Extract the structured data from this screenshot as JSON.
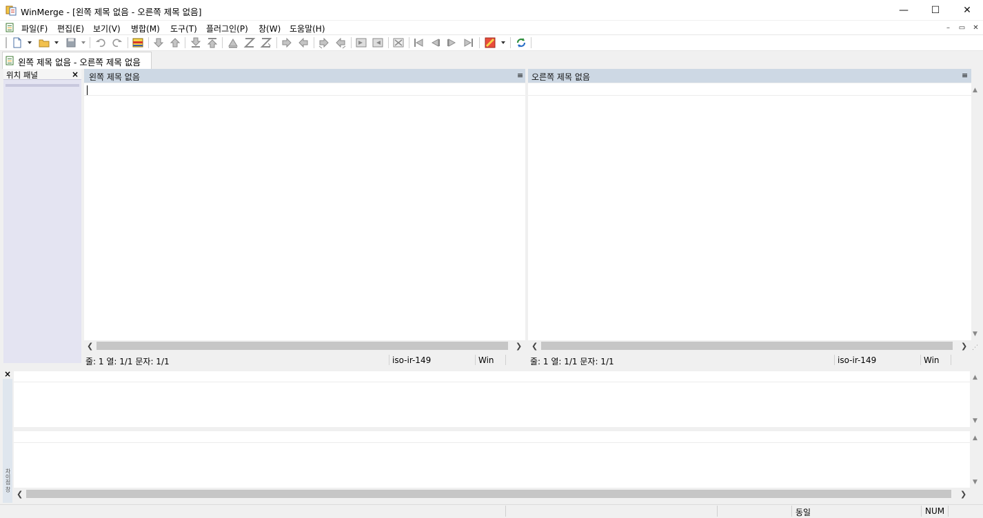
{
  "window": {
    "title": "WinMerge - [왼쪽 제목 없음 - 오른쪽 제목 없음]",
    "minimize_glyph": "—",
    "maximize_glyph": "☐",
    "close_glyph": "✕"
  },
  "menu": {
    "items": [
      "파일(F)",
      "편집(E)",
      "보기(V)",
      "병합(M)",
      "도구(T)",
      "플러그인(P)",
      "창(W)",
      "도움말(H)"
    ],
    "mdi_minimize": "–",
    "mdi_restore": "▭",
    "mdi_close": "✕"
  },
  "toolbar": {
    "icons": [
      "new-document-icon",
      "open-folder-icon",
      "save-icon",
      "undo-icon",
      "redo-icon",
      "filter-icon",
      "next-diff-icon",
      "prev-diff-icon",
      "first-diff-icon",
      "last-diff-icon",
      "current-diff-icon",
      "next-conflict-icon",
      "prev-conflict-icon",
      "copy-right-icon",
      "copy-left-icon",
      "copy-right-advance-icon",
      "copy-left-advance-icon",
      "copy-all-right-icon",
      "copy-all-left-icon",
      "all-icon",
      "first-file-icon",
      "prev-file-icon",
      "next-file-icon",
      "last-file-icon",
      "options-icon",
      "refresh-icon"
    ]
  },
  "tab": {
    "label": "왼쪽 제목 없음 - 오른쪽 제목 없음"
  },
  "location_pane": {
    "title": "위치 패널",
    "close": "×"
  },
  "left_pane": {
    "header": "왼쪽 제목 없음",
    "menu_glyph": "≡",
    "status": {
      "position": "줄: 1  열: 1/1  문자: 1/1",
      "encoding": "iso-ir-149",
      "eol": "Win"
    }
  },
  "right_pane": {
    "header": "오른쪽 제목 없음",
    "menu_glyph": "≡",
    "status": {
      "position": "줄: 1  열: 1/1  문자: 1/1",
      "encoding": "iso-ir-149",
      "eol": "Win"
    }
  },
  "detail_pane": {
    "close": "×",
    "side_label": "차이점 창"
  },
  "statusbar": {
    "result": "동일",
    "num": "NUM"
  },
  "colors": {
    "pane_header": "#cdd8e4",
    "location_pane": "#e4e4f2",
    "accent_green": "#3a8f2a",
    "accent_orange": "#e5a21a"
  }
}
